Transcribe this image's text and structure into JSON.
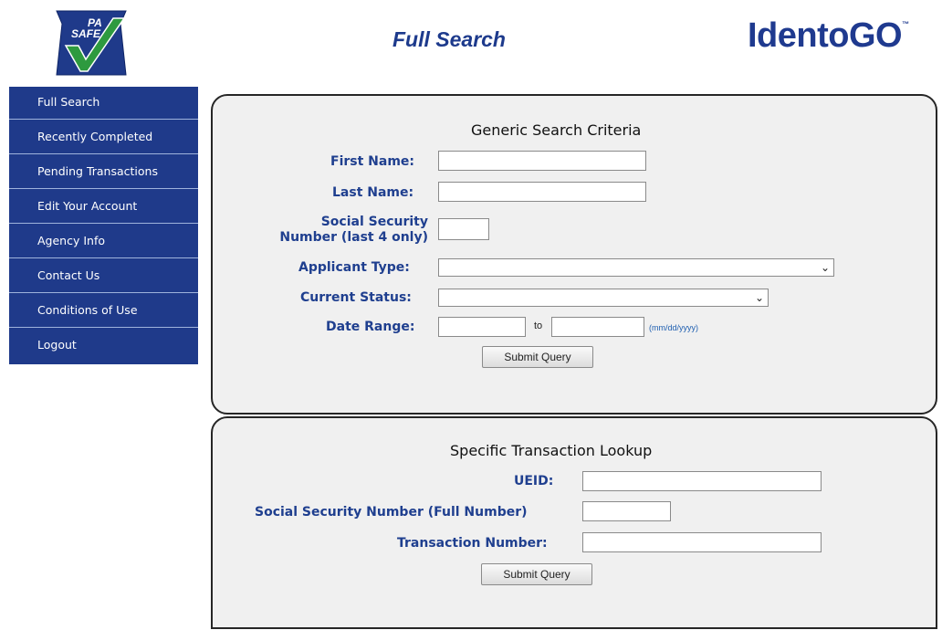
{
  "header": {
    "logo_text": "PA SAFE",
    "page_title": "Full Search",
    "brand": "IdentoGO",
    "brand_tm": "™"
  },
  "sidebar": {
    "items": [
      {
        "label": "Full Search"
      },
      {
        "label": "Recently Completed"
      },
      {
        "label": "Pending Transactions"
      },
      {
        "label": "Edit Your Account"
      },
      {
        "label": "Agency Info"
      },
      {
        "label": "Contact Us"
      },
      {
        "label": "Conditions of Use"
      },
      {
        "label": "Logout"
      }
    ]
  },
  "generic_search": {
    "heading": "Generic Search Criteria",
    "first_name_label": "First Name:",
    "first_name_value": "",
    "last_name_label": "Last Name:",
    "last_name_value": "",
    "ssn_label_line1": "Social Security",
    "ssn_label_line2": "Number (last 4 only)",
    "ssn_value": "",
    "applicant_type_label": "Applicant Type:",
    "applicant_type_value": "",
    "current_status_label": "Current Status:",
    "current_status_value": "",
    "date_range_label": "Date Range:",
    "date_from_value": "",
    "date_to_label": "to",
    "date_to_value": "",
    "date_hint": "(mm/dd/yyyy)",
    "submit_label": "Submit Query"
  },
  "transaction_lookup": {
    "heading": "Specific Transaction Lookup",
    "ueid_label": "UEID:",
    "ueid_value": "",
    "ssn_full_label": "Social Security Number (Full Number)",
    "ssn_full_value": "",
    "transaction_number_label": "Transaction Number:",
    "transaction_number_value": "",
    "submit_label": "Submit Query"
  },
  "colors": {
    "sidebar_bg": "#1f3a8a",
    "label_blue": "#1f3f8f",
    "panel_bg": "#f0f0f0",
    "logo_green": "#2e9a3f"
  },
  "icons": {
    "logo": "pa-safe-keystone-checkmark-logo",
    "dropdown": "chevron-down-icon"
  }
}
